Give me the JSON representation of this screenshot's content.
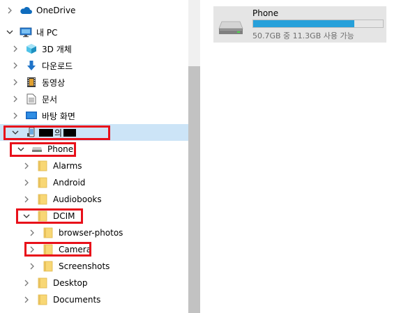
{
  "nav": {
    "items": [
      {
        "label": "OneDrive",
        "icon": "onedrive-cloud-icon",
        "chevron": "right"
      },
      {
        "label": "내 PC",
        "icon": "this-pc-icon",
        "chevron": "down"
      },
      {
        "label": "3D 개체",
        "icon": "3d-objects-icon",
        "chevron": "right"
      },
      {
        "label": "다운로드",
        "icon": "downloads-icon",
        "chevron": "right"
      },
      {
        "label": "동영상",
        "icon": "videos-icon",
        "chevron": "right"
      },
      {
        "label": "문서",
        "icon": "documents-icon",
        "chevron": "right"
      },
      {
        "label": "바탕 화면",
        "icon": "desktop-icon",
        "chevron": "right"
      },
      {
        "label": "의",
        "icon": "phone-device-icon",
        "chevron": "down",
        "selected": true,
        "redacted": true
      },
      {
        "label": "Phone",
        "icon": "drive-icon",
        "chevron": "down"
      },
      {
        "label": "Alarms",
        "icon": "folder-icon",
        "chevron": "right"
      },
      {
        "label": "Android",
        "icon": "folder-icon",
        "chevron": "right"
      },
      {
        "label": "Audiobooks",
        "icon": "folder-icon",
        "chevron": "right"
      },
      {
        "label": "DCIM",
        "icon": "folder-icon",
        "chevron": "down"
      },
      {
        "label": "browser-photos",
        "icon": "folder-icon",
        "chevron": "right"
      },
      {
        "label": "Camera",
        "icon": "folder-icon",
        "chevron": "right"
      },
      {
        "label": "Screenshots",
        "icon": "folder-icon",
        "chevron": "right"
      },
      {
        "label": "Desktop",
        "icon": "folder-icon",
        "chevron": "right"
      },
      {
        "label": "Documents",
        "icon": "folder-icon",
        "chevron": "right"
      }
    ]
  },
  "content": {
    "drive": {
      "name": "Phone",
      "space_text": "50.7GB 중 11.3GB 사용 가능",
      "used_fraction": 0.777,
      "icon": "drive-icon"
    }
  },
  "colors": {
    "selection": "#cce4f7",
    "progress": "#26a0da",
    "highlight_box": "#e8101a",
    "folder": "#f8d775"
  }
}
